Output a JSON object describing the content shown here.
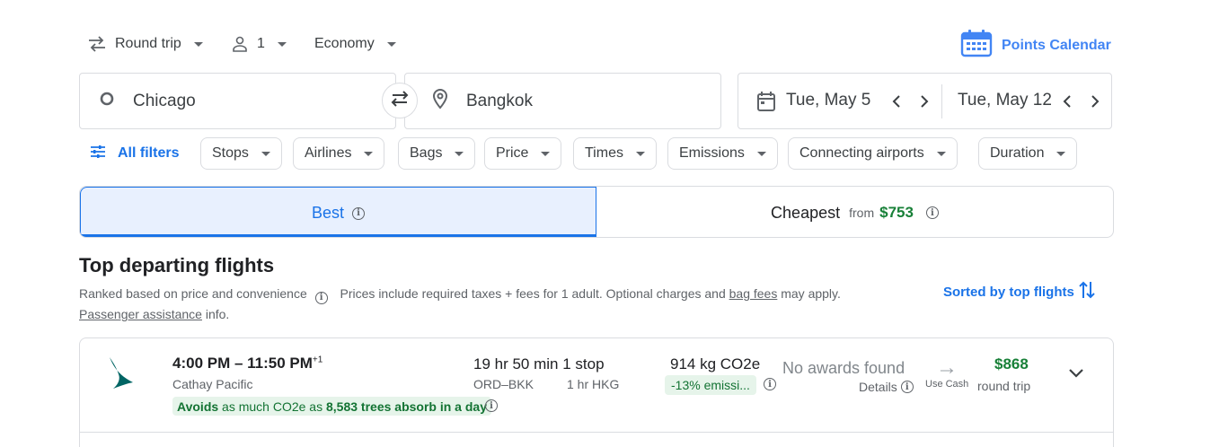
{
  "top_options": {
    "trip_type": "Round trip",
    "passengers": "1",
    "cabin": "Economy"
  },
  "points_calendar": {
    "label": "Points Calendar"
  },
  "search": {
    "origin": "Chicago",
    "destination": "Bangkok",
    "depart_date": "Tue, May 5",
    "return_date": "Tue, May 12"
  },
  "filters": {
    "all_filters": "All filters",
    "chips": [
      "Stops",
      "Airlines",
      "Bags",
      "Price",
      "Times",
      "Emissions",
      "Connecting airports",
      "Duration"
    ]
  },
  "tabs": {
    "best": "Best",
    "cheapest": "Cheapest",
    "cheapest_from": "from",
    "cheapest_price": "$753"
  },
  "results": {
    "heading": "Top departing flights",
    "ranked_text": "Ranked based on price and convenience",
    "prices_text": "Prices include required taxes + fees for 1 adult. Optional charges and",
    "bag_fees_link": "bag fees",
    "may_apply": "may apply.",
    "passenger_link": "Passenger assistance",
    "info_text": "info.",
    "sorted_label": "Sorted by top flights"
  },
  "flights": [
    {
      "times": "4:00 PM – 11:50 PM",
      "day_offset": "+1",
      "airline": "Cathay Pacific",
      "eco_avoids": "Avoids",
      "eco_mid": "as much CO2e as",
      "eco_trees": "8,583 trees absorb in a day",
      "duration": "19 hr 50 min",
      "stops": "1 stop",
      "route": "ORD–BKK",
      "layover": "1 hr HKG",
      "co2": "914 kg CO2e",
      "emissions_badge": "-13% emissi...",
      "awards": "No awards found",
      "details": "Details",
      "use_cash": "Use Cash",
      "price": "$868",
      "price_note": "round trip"
    }
  ],
  "colors": {
    "accent": "#1a73e8",
    "green": "#188038",
    "eco_bg": "#e6f4ea"
  }
}
